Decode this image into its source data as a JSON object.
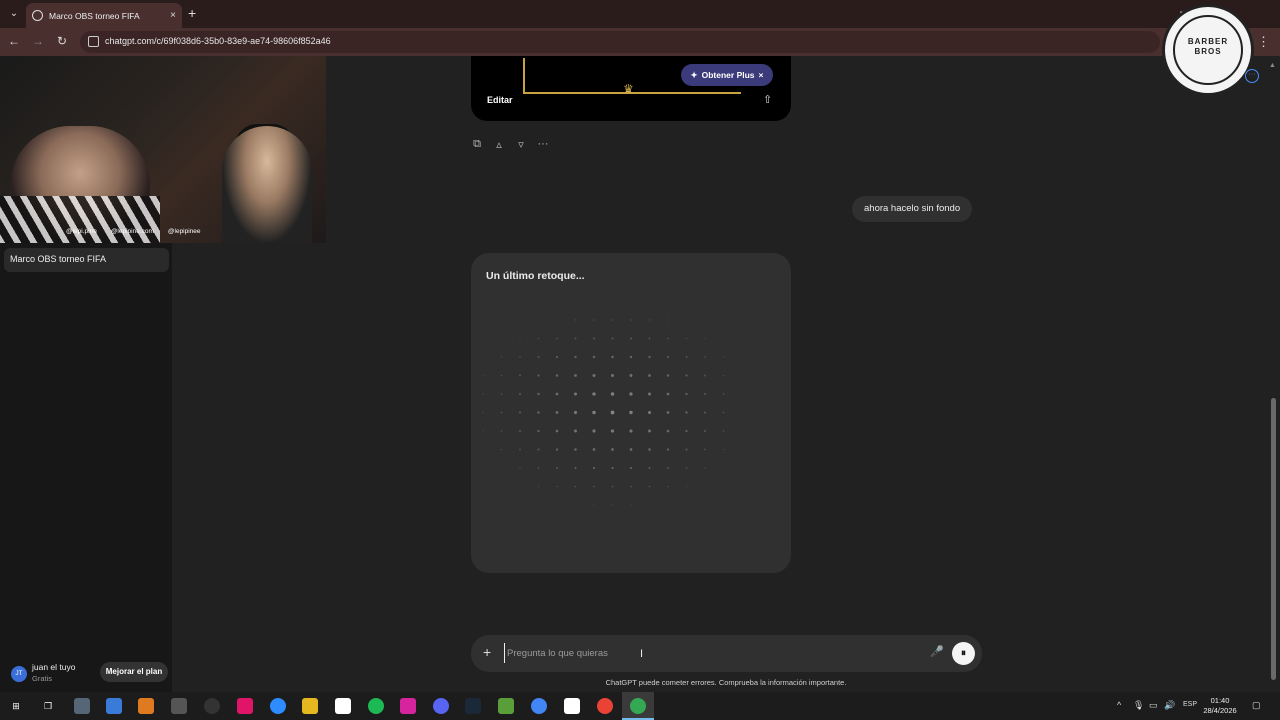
{
  "browser": {
    "tab_title": "Marco OBS torneo FIFA",
    "tab_close": "×",
    "new_tab": "+",
    "url": "chatgpt.com/c/69f038d6-35b0-83e9-ae74-98606f852a46",
    "back": "←",
    "forward": "→",
    "reload": "↻",
    "menu": "⋮",
    "minimize": "—",
    "maximize": "▢",
    "close": "✕"
  },
  "sidebar": {
    "active_chat": "Marco OBS torneo FIFA",
    "user_initials": "JT",
    "user_name": "juan el tuyo",
    "user_plan": "Gratis",
    "upgrade_label": "Mejorar el plan"
  },
  "webcam": {
    "social_1": "@lepi.pine",
    "social_2": "@lepipine.com",
    "social_3": "@lepipinee"
  },
  "logo": {
    "line1": "BARBER",
    "line2": "BROS"
  },
  "chat": {
    "plus_pill": "Obtener Plus",
    "plus_icon": "✦",
    "plus_close": "×",
    "edit_label": "Editar",
    "share_icon": "⇧",
    "actions": {
      "copy": "⧉",
      "like": "👍",
      "dislike": "👎",
      "more": "···"
    },
    "user_message": "ahora hacelo sin fondo",
    "gen_title": "Un último retoque..."
  },
  "composer": {
    "plus": "+",
    "placeholder": "Pregunta lo que quieras",
    "mic": "🎙",
    "voice": "|||",
    "disclaimer": "ChatGPT puede cometer errores. Comprueba la información importante."
  },
  "taskbar": {
    "lang": "ESP",
    "time": "01:40",
    "date": "28/4/2026"
  },
  "colors": {
    "accent_plus": "#3b3a7a",
    "background": "#212121",
    "sidebar": "#171717",
    "browser_chrome": "#4a2f2f"
  }
}
